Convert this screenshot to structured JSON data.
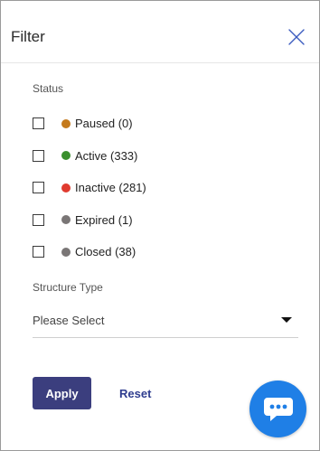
{
  "header": {
    "title": "Filter"
  },
  "status_section": {
    "label": "Status",
    "options": [
      {
        "label": "Paused (0)",
        "color": "#c47a1c",
        "checked": false
      },
      {
        "label": "Active (333)",
        "color": "#3a8f2e",
        "checked": false
      },
      {
        "label": "Inactive (281)",
        "color": "#e03b2f",
        "checked": false
      },
      {
        "label": "Expired (1)",
        "color": "#7a7676",
        "checked": false
      },
      {
        "label": "Closed (38)",
        "color": "#7a7676",
        "checked": false
      }
    ]
  },
  "structure_section": {
    "label": "Structure Type",
    "select_value": "Please Select"
  },
  "actions": {
    "apply_label": "Apply",
    "reset_label": "Reset"
  },
  "icons": {
    "close": "close-icon",
    "chat": "chat-bubble-icon",
    "dropdown": "caret-down-icon"
  },
  "colors": {
    "primary": "#3b3e7e",
    "link": "#2f3d8f",
    "chat": "#1f7fe6"
  }
}
